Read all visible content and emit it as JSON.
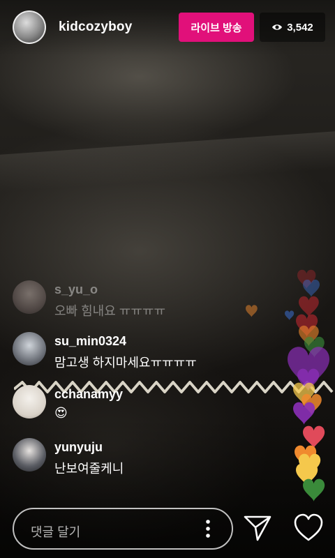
{
  "header": {
    "username": "kidcozyboy",
    "live_label": "라이브 방송",
    "viewer_count": "3,542"
  },
  "comments": [
    {
      "username": "s_yu_o",
      "text": "오빠 힘내요 ㅠㅠㅠㅠ",
      "faded": true
    },
    {
      "username": "su_min0324",
      "text": "맘고생 하지마세요ㅠㅠㅠㅠ",
      "faded": false
    },
    {
      "username": "cchanamyy",
      "text": "😍",
      "faded": false
    },
    {
      "username": "yunyuju",
      "text": "난보여줄케니",
      "faded": false
    }
  ],
  "composer": {
    "placeholder": "댓글 달기"
  },
  "icons": {
    "viewers": "eye-icon",
    "more": "more-vertical-icon",
    "send": "send-icon",
    "like": "heart-icon"
  },
  "colors": {
    "live_badge": "#e1107a",
    "heart_palette": [
      "#c0282f",
      "#e04a5a",
      "#f08a2e",
      "#f5c84c",
      "#8b2fb8",
      "#3a8a3a",
      "#3c6fd0"
    ]
  }
}
